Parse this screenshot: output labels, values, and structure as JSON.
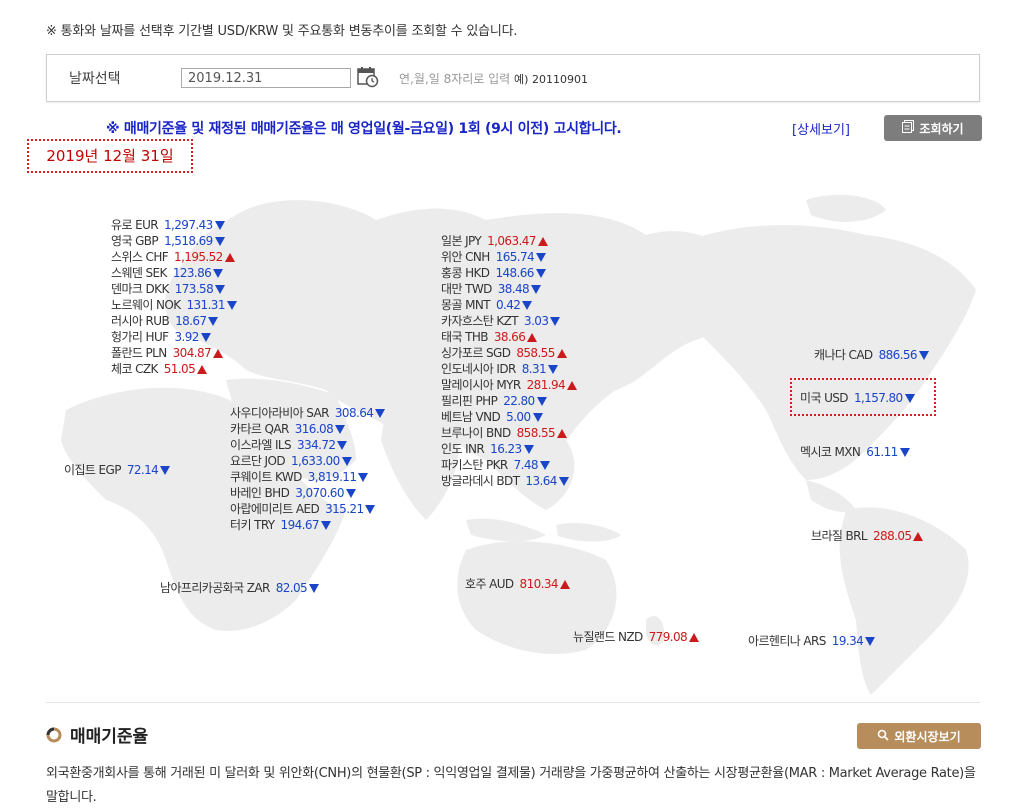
{
  "notice": "※ 통화와 날짜를 선택후 기간별 USD/KRW 및 주요통화 변동추이를 조회할 수 있습니다.",
  "date_select": {
    "label": "날짜선택",
    "value": "2019.12.31",
    "hint": "연,월,일 8자리로 입력",
    "example": "예) 20110901"
  },
  "announce": "※ 매매기준율 및 재정된 매매기준율은 매 영업일(월-금요일) 1회 (9시 이전) 고시합니다.",
  "detail_link": "[상세보기]",
  "query_button": "조회하기",
  "selected_date": "2019년 12월 31일",
  "rates": {
    "eur": {
      "name": "유로 EUR",
      "value": "1,297.43",
      "trend": "down"
    },
    "gbp": {
      "name": "영국 GBP",
      "value": "1,518.69",
      "trend": "down"
    },
    "chf": {
      "name": "스위스 CHF",
      "value": "1,195.52",
      "trend": "up"
    },
    "sek": {
      "name": "스웨덴 SEK",
      "value": "123.86",
      "trend": "down"
    },
    "dkk": {
      "name": "덴마크 DKK",
      "value": "173.58",
      "trend": "down"
    },
    "nok": {
      "name": "노르웨이 NOK",
      "value": "131.31",
      "trend": "down"
    },
    "rub": {
      "name": "러시아 RUB",
      "value": "18.67",
      "trend": "down"
    },
    "huf": {
      "name": "헝가리 HUF",
      "value": "3.92",
      "trend": "down"
    },
    "pln": {
      "name": "폴란드 PLN",
      "value": "304.87",
      "trend": "up"
    },
    "czk": {
      "name": "체코 CZK",
      "value": "51.05",
      "trend": "up"
    },
    "jpy": {
      "name": "일본 JPY",
      "value": "1,063.47",
      "trend": "up"
    },
    "cnh": {
      "name": "위안 CNH",
      "value": "165.74",
      "trend": "down"
    },
    "hkd": {
      "name": "홍콩 HKD",
      "value": "148.66",
      "trend": "down"
    },
    "twd": {
      "name": "대만 TWD",
      "value": "38.48",
      "trend": "down"
    },
    "mnt": {
      "name": "몽골 MNT",
      "value": "0.42",
      "trend": "down"
    },
    "kzt": {
      "name": "카자흐스탄 KZT",
      "value": "3.03",
      "trend": "down"
    },
    "thb": {
      "name": "태국 THB",
      "value": "38.66",
      "trend": "up"
    },
    "sgd": {
      "name": "싱가포르 SGD",
      "value": "858.55",
      "trend": "up"
    },
    "idr": {
      "name": "인도네시아 IDR",
      "value": "8.31",
      "trend": "down"
    },
    "myr": {
      "name": "말레이시아 MYR",
      "value": "281.94",
      "trend": "up"
    },
    "php": {
      "name": "필리핀 PHP",
      "value": "22.80",
      "trend": "down"
    },
    "vnd": {
      "name": "베트남 VND",
      "value": "5.00",
      "trend": "down"
    },
    "bnd": {
      "name": "브루나이 BND",
      "value": "858.55",
      "trend": "up"
    },
    "inr": {
      "name": "인도 INR",
      "value": "16.23",
      "trend": "down"
    },
    "pkr": {
      "name": "파키스탄 PKR",
      "value": "7.48",
      "trend": "down"
    },
    "bdt": {
      "name": "방글라데시 BDT",
      "value": "13.64",
      "trend": "down"
    },
    "sar": {
      "name": "사우디아라비아 SAR",
      "value": "308.64",
      "trend": "down"
    },
    "qar": {
      "name": "카타르 QAR",
      "value": "316.08",
      "trend": "down"
    },
    "ils": {
      "name": "이스라엘 ILS",
      "value": "334.72",
      "trend": "down"
    },
    "jod": {
      "name": "요르단 JOD",
      "value": "1,633.00",
      "trend": "down"
    },
    "kwd": {
      "name": "쿠웨이트 KWD",
      "value": "3,819.11",
      "trend": "down"
    },
    "bhd": {
      "name": "바레인 BHD",
      "value": "3,070.60",
      "trend": "down"
    },
    "aed": {
      "name": "아랍에미리트 AED",
      "value": "315.21",
      "trend": "down"
    },
    "try": {
      "name": "터키 TRY",
      "value": "194.67",
      "trend": "down"
    },
    "egp": {
      "name": "이집트 EGP",
      "value": "72.14",
      "trend": "down"
    },
    "zar": {
      "name": "남아프리카공화국 ZAR",
      "value": "82.05",
      "trend": "down"
    },
    "aud": {
      "name": "호주 AUD",
      "value": "810.34",
      "trend": "up"
    },
    "nzd": {
      "name": "뉴질랜드 NZD",
      "value": "779.08",
      "trend": "up"
    },
    "cad": {
      "name": "캐나다 CAD",
      "value": "886.56",
      "trend": "down"
    },
    "usd": {
      "name": "미국 USD",
      "value": "1,157.80",
      "trend": "down"
    },
    "mxn": {
      "name": "멕시코 MXN",
      "value": "61.11",
      "trend": "down"
    },
    "brl": {
      "name": "브라질 BRL",
      "value": "288.05",
      "trend": "up"
    },
    "ars": {
      "name": "아르헨티나 ARS",
      "value": "19.34",
      "trend": "down"
    }
  },
  "section": {
    "title": "매매기준율",
    "fx_button": "외환시장보기",
    "description": "외국환중개회사를 통해 거래된 미 달러화 및 위안화(CNH)의 현물환(SP : 익익영업일 결제물) 거래량을 가중평균하여 산출하는 시장평균환율(MAR : Market Average Rate)을 말합니다."
  }
}
